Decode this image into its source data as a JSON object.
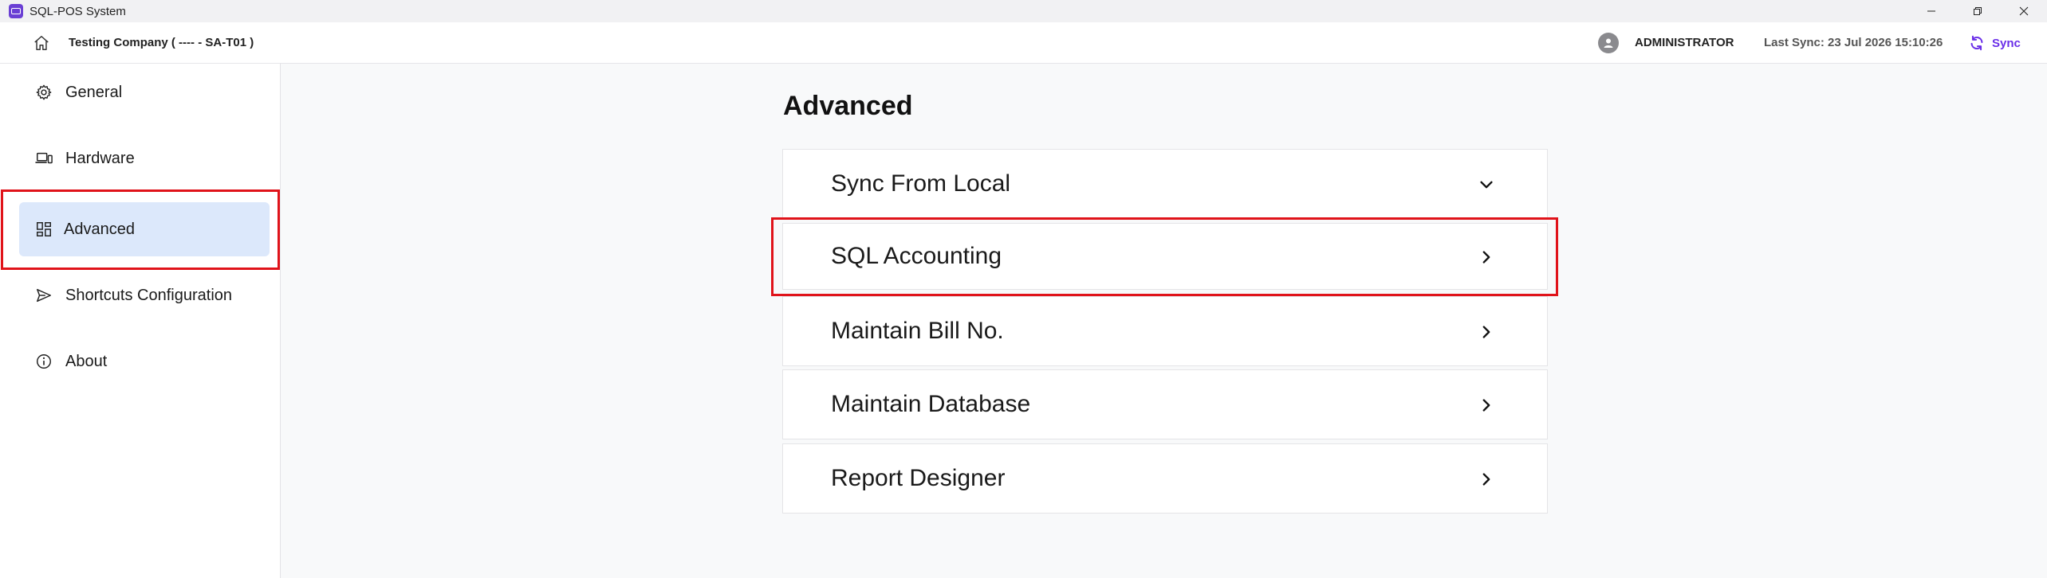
{
  "window": {
    "title": "SQL-POS System",
    "controls": [
      "minimize",
      "restore",
      "close"
    ]
  },
  "header": {
    "company": "Testing Company ( ---- - SA-T01 )",
    "user": "ADMINISTRATOR",
    "last_sync": "Last Sync: 23 Jul 2026 15:10:26",
    "sync_label": "Sync",
    "accent_color": "#6a2ee8"
  },
  "sidebar": {
    "items": [
      {
        "label": "General",
        "icon": "gear-icon"
      },
      {
        "label": "Hardware",
        "icon": "laptop-icon"
      },
      {
        "label": "Advanced",
        "icon": "dashboard-grid-icon",
        "active": true
      },
      {
        "label": "Shortcuts Configuration",
        "icon": "send-icon"
      },
      {
        "label": "About",
        "icon": "info-icon"
      }
    ],
    "active_color": "#dce8fb"
  },
  "main": {
    "title": "Advanced",
    "panels": [
      {
        "label": "Sync From Local",
        "chevron": "down"
      },
      {
        "label": "SQL Accounting",
        "chevron": "right"
      },
      {
        "label": "Maintain Bill No.",
        "chevron": "right"
      },
      {
        "label": "Maintain Database",
        "chevron": "right"
      },
      {
        "label": "Report Designer",
        "chevron": "right"
      }
    ]
  },
  "highlight_color": "#e0131a"
}
